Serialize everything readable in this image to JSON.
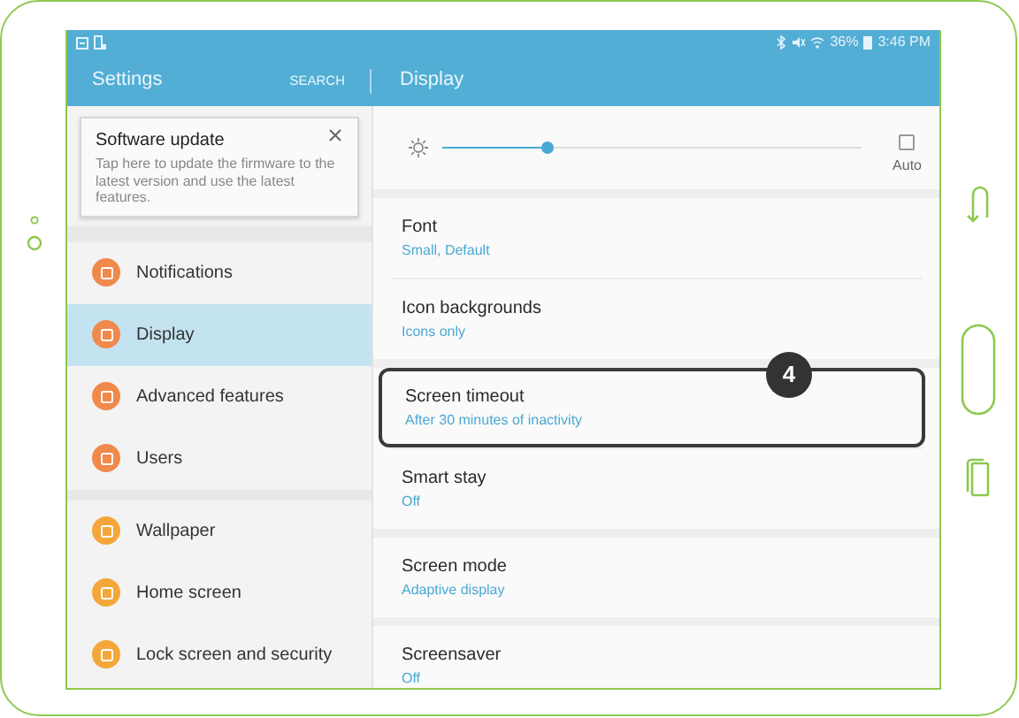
{
  "status_bar": {
    "battery": "36%",
    "time": "3:46 PM"
  },
  "header": {
    "title": "Settings",
    "search": "SEARCH",
    "section_title": "Display"
  },
  "update_card": {
    "title": "Software update",
    "text": "Tap here to update the firmware to the latest version and use the latest features."
  },
  "sidebar": {
    "sections": [
      {
        "items": [
          {
            "label": "Notifications",
            "color": "#f0894c",
            "selected": false
          },
          {
            "label": "Display",
            "color": "#f0894c",
            "selected": true
          },
          {
            "label": "Advanced features",
            "color": "#f0894c",
            "selected": false
          },
          {
            "label": "Users",
            "color": "#f0894c",
            "selected": false
          }
        ]
      },
      {
        "items": [
          {
            "label": "Wallpaper",
            "color": "#f3a73a",
            "selected": false
          },
          {
            "label": "Home screen",
            "color": "#f3a73a",
            "selected": false
          },
          {
            "label": "Lock screen and security",
            "color": "#f3a73a",
            "selected": false
          }
        ]
      }
    ]
  },
  "brightness": {
    "level": 0.25,
    "auto_label": "Auto",
    "auto_checked": false
  },
  "settings": {
    "sections": [
      {
        "items": [
          {
            "title": "Font",
            "value": "Small, Default"
          },
          {
            "title": "Icon backgrounds",
            "value": "Icons only"
          }
        ]
      },
      {
        "items": [
          {
            "title": "Screen timeout",
            "value": "After 30 minutes of inactivity",
            "callout": "4"
          },
          {
            "title": "Smart stay",
            "value": "Off"
          }
        ]
      },
      {
        "items": [
          {
            "title": "Screen mode",
            "value": "Adaptive display"
          }
        ]
      },
      {
        "items": [
          {
            "title": "Screensaver",
            "value": "Off"
          }
        ]
      }
    ]
  }
}
